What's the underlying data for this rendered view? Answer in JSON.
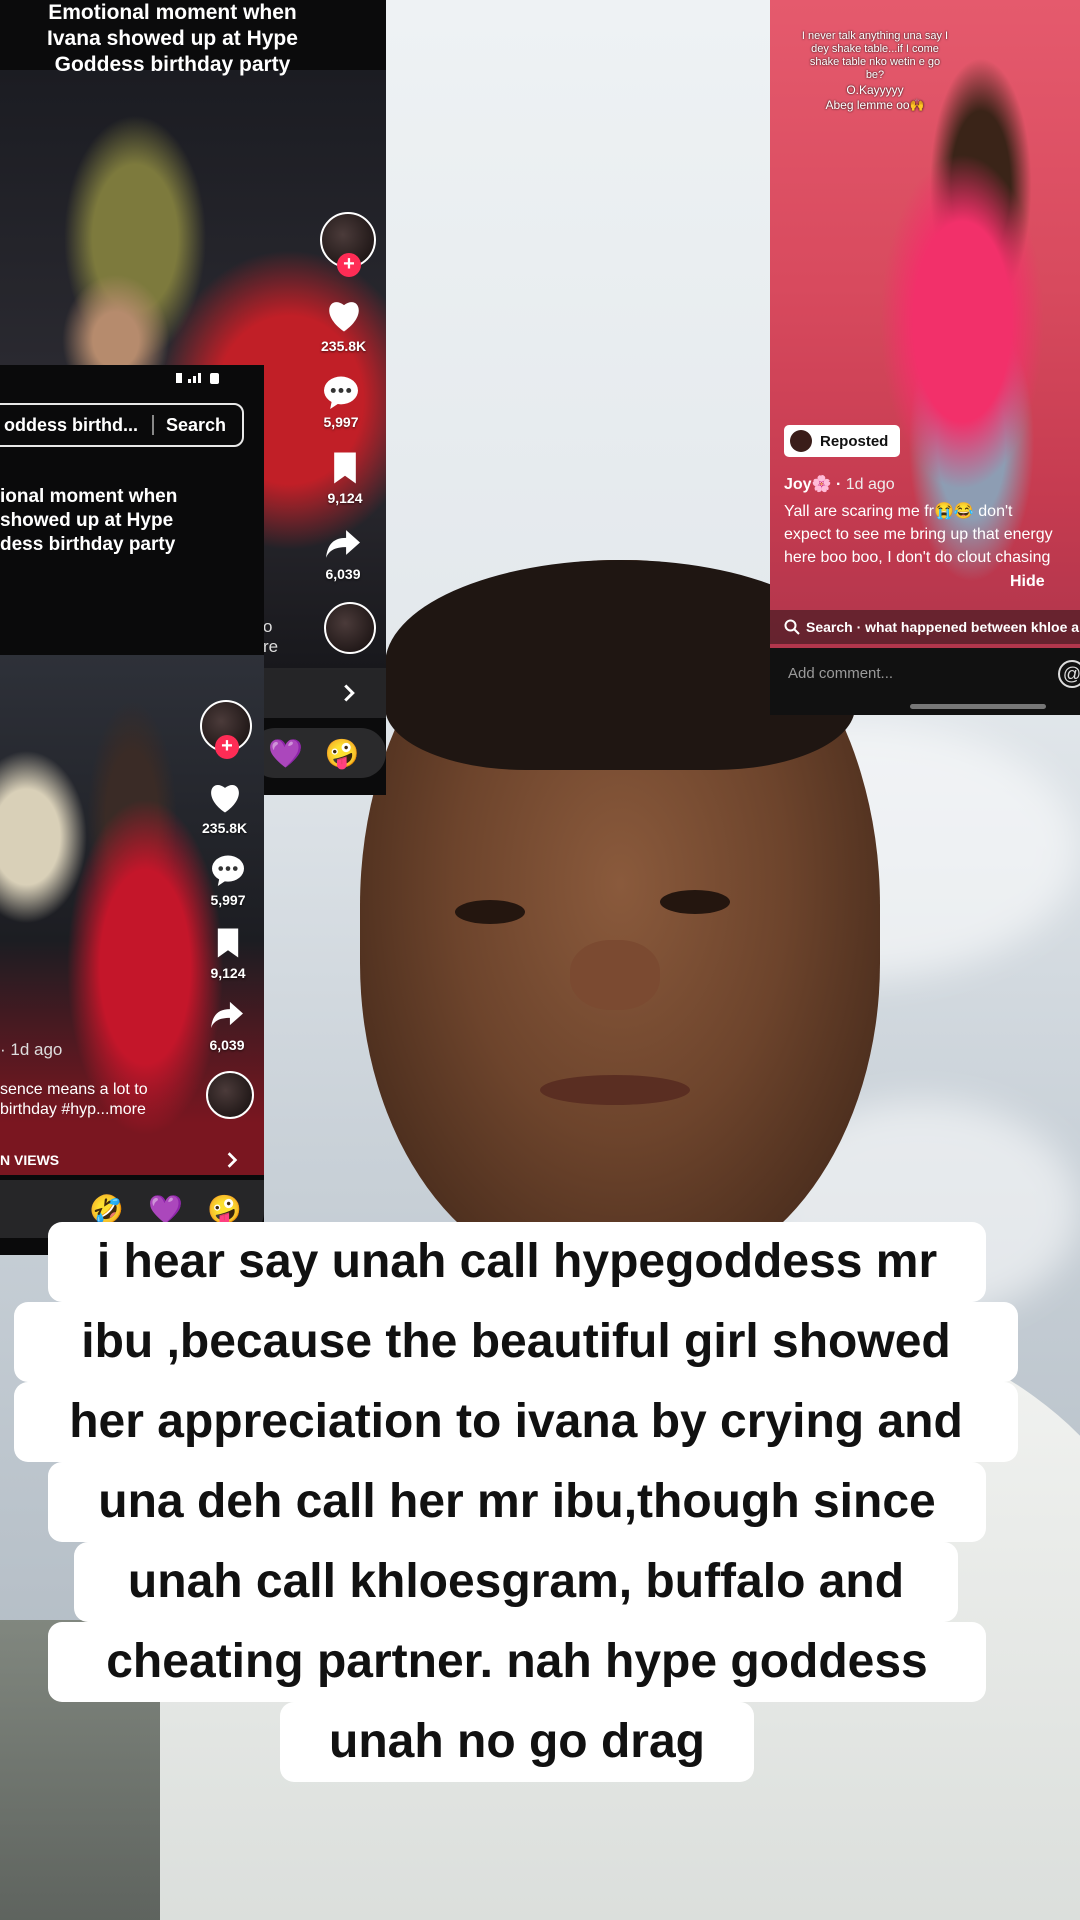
{
  "card1": {
    "caption_lines": [
      "Emotional moment when",
      "Ivana showed up at Hype",
      "Goddess birthday party"
    ],
    "likes": "235.8K",
    "comments": "5,997",
    "saves": "9,124",
    "shares": "6,039",
    "partial_text_1": "o",
    "partial_text_2": "re",
    "emoji_1": "💜",
    "emoji_2": "🤪"
  },
  "card2": {
    "search_query": "oddess birthd...",
    "search_button": "Search",
    "caption_lines": [
      "ional moment when",
      "showed up at Hype",
      "dess birthday party"
    ],
    "likes": "235.8K",
    "comments": "5,997",
    "saves": "9,124",
    "shares": "6,039",
    "time": "· 1d ago",
    "desc_line1": "sence means a lot to",
    "desc_line2": "birthday #hyp...more",
    "views_label": "N VIEWS",
    "emoji_1": "🤣",
    "emoji_2": "💜",
    "emoji_3": "🤪"
  },
  "card3": {
    "top_text_lines": [
      "I never talk anything una say I",
      "dey shake table...if I come",
      "shake table nko wetin e go",
      "be?",
      "O.Kayyyyy",
      "Abeg lemme oo🙌"
    ],
    "reposted_label": "Reposted",
    "author": "Joy🌸 ·",
    "time": "1d ago",
    "desc": "Yall are scaring me fr😭😂 don't expect to see me bring up that energy here boo boo, I don't do clout chasing",
    "hide_label": "Hide",
    "search_text": "Search · what happened between khloe a",
    "comment_placeholder": "Add comment..."
  },
  "overlay": {
    "lines": [
      "i hear say unah call hypegoddess mr",
      "ibu ,because the beautiful girl  showed",
      "her appreciation to ivana by crying and",
      "una deh call her mr ibu,though since",
      "unah call khloesgram, buffalo and",
      "cheating partner. nah hype goddess",
      "unah no go drag"
    ]
  },
  "icons": {
    "like": "heart-icon",
    "comment": "comment-icon",
    "save": "bookmark-icon",
    "share": "share-icon",
    "search": "search-icon",
    "mention": "at-icon",
    "chevron": "chevron-right-icon"
  },
  "colors": {
    "accent": "#fe2c55",
    "caption_bg": "#ffffff",
    "caption_text": "#111111"
  }
}
